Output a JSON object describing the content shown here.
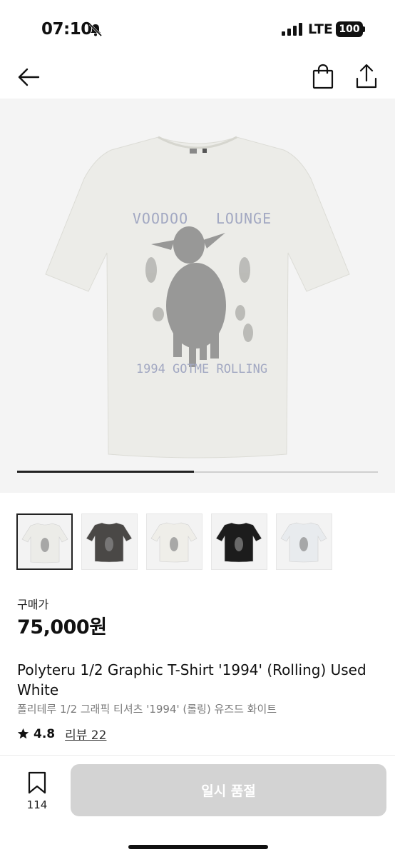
{
  "status_bar": {
    "time": "07:10",
    "network": "LTE",
    "battery": "100"
  },
  "nav": {
    "back_icon": "arrow-left-icon",
    "bag_icon": "shopping-bag-icon",
    "share_icon": "share-icon"
  },
  "gallery": {
    "progress": 0.49,
    "shirt_print": {
      "top_left": "VOODOO",
      "top_right": "LOUNGE",
      "bottom": "1994 GOTME ROLLING"
    },
    "thumbnails": [
      {
        "color": "#ecece8",
        "selected": true
      },
      {
        "color": "#4a4846",
        "selected": false
      },
      {
        "color": "#efeee9",
        "selected": false
      },
      {
        "color": "#1c1c1c",
        "selected": false
      },
      {
        "color": "#e8ebee",
        "selected": false
      }
    ]
  },
  "price": {
    "label": "구매가",
    "value": "75,000원"
  },
  "product": {
    "title_en": "Polyteru 1/2 Graphic T-Shirt '1994' (Rolling) Used White",
    "title_ko": "폴리테루 1/2 그래픽 티셔츠 '1994' (롤링) 유즈드 화이트",
    "rating": "4.8",
    "reviews": "리뷰 22"
  },
  "bottom_bar": {
    "wish_count": "114",
    "buy_label": "일시 품절"
  }
}
